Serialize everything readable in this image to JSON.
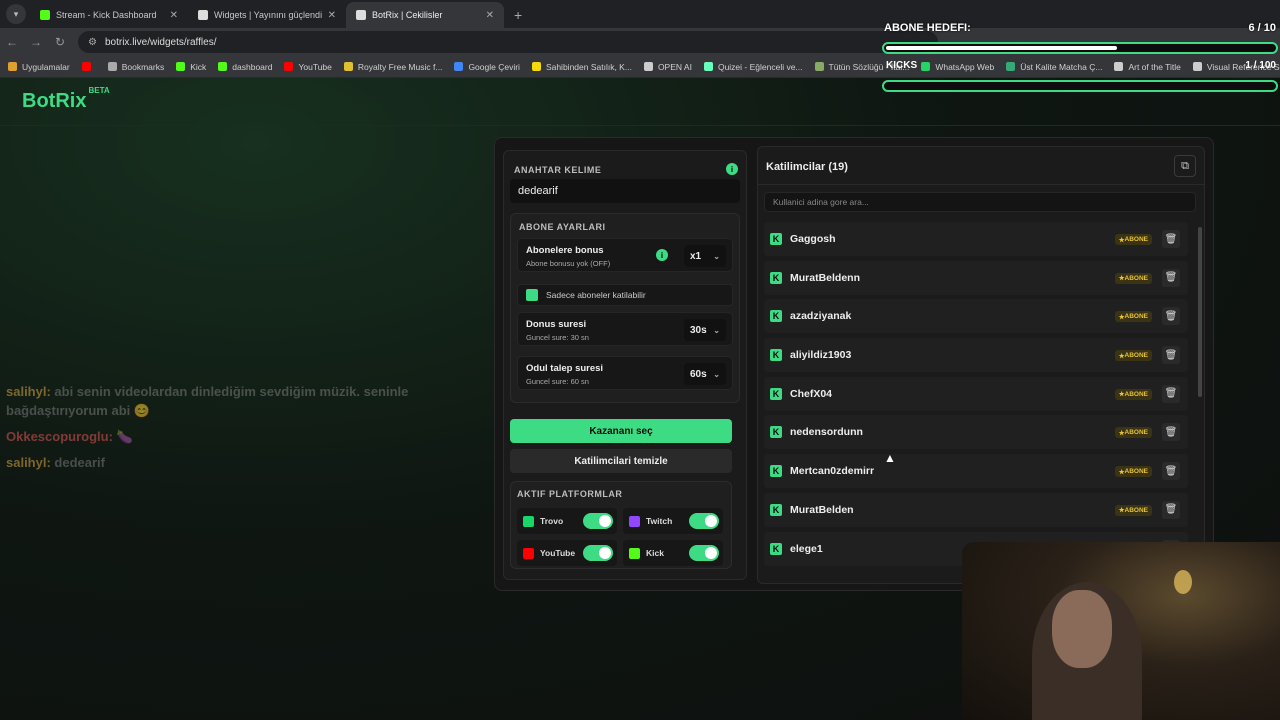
{
  "browser": {
    "tabs": [
      {
        "label": "Stream - Kick Dashboard",
        "color": "#53fc18"
      },
      {
        "label": "Widgets | Yayınını güçlendirmek",
        "color": "#ddd"
      },
      {
        "label": "BotRix | Cekilisler",
        "color": "#ddd"
      }
    ],
    "url": "botrix.live/widgets/raffles/",
    "bookmarks": [
      {
        "label": "Uygulamalar",
        "color": "#e0a030"
      },
      {
        "label": "",
        "color": "#ff0000"
      },
      {
        "label": "Bookmarks",
        "color": "#aaa"
      },
      {
        "label": "Kick",
        "color": "#53fc18"
      },
      {
        "label": "dashboard",
        "color": "#53fc18"
      },
      {
        "label": "YouTube",
        "color": "#ff0000"
      },
      {
        "label": "Royalty Free Music f...",
        "color": "#e0c030"
      },
      {
        "label": "Google Çeviri",
        "color": "#4285f4"
      },
      {
        "label": "Sahibinden Satılık, K...",
        "color": "#f5d90a"
      },
      {
        "label": "OPEN AI",
        "color": "#ccc"
      },
      {
        "label": "Quizei - Eğlenceli ve...",
        "color": "#6fb"
      },
      {
        "label": "Tütün Sözlüğü - İtal...",
        "color": "#8a6"
      },
      {
        "label": "WhatsApp Web",
        "color": "#25d366"
      },
      {
        "label": "Üst Kalite Matcha Ç...",
        "color": "#3a7"
      },
      {
        "label": "Art of the Title",
        "color": "#ccc"
      },
      {
        "label": "Visual Reference Se...",
        "color": "#ccc"
      }
    ]
  },
  "site": {
    "logo": "BotRix",
    "logo_sup": "BETA"
  },
  "chat": [
    {
      "user": "salihyl:",
      "text": " abi senin videolardan dinlediğim sevdiğim müzik. seninle bağdaştırıyorum abi 😊",
      "ucls": "u1"
    },
    {
      "user": "Okkescopuroglu:",
      "text": " 🍆",
      "ucls": "u2"
    },
    {
      "user": "salihyl:",
      "text": " dedearif",
      "ucls": "u1"
    }
  ],
  "raffle": {
    "keyword_title": "ANAHTAR KELIME",
    "keyword_value": "dedearif",
    "sub_title": "ABONE AYARLARI",
    "sub_bonus_label": "Abonelere bonus",
    "sub_bonus_sub": "Abone bonusu yok (OFF)",
    "sub_bonus_value": "x1",
    "subs_only_label": "Sadece aboneler katilabilir",
    "duration_label": "Donus suresi",
    "duration_sub": "Guncel sure: 30 sn",
    "duration_value": "30s",
    "claim_label": "Odul talep suresi",
    "claim_sub": "Guncel sure: 60 sn",
    "claim_value": "60s",
    "pick_button": "Kazananı seç",
    "clear_button": "Katilimcilari temizle",
    "platforms_title": "AKTIF PLATFORMLAR",
    "platforms": [
      {
        "name": "Trovo",
        "color": "#19d66b",
        "icon": "trovo-icon"
      },
      {
        "name": "Twitch",
        "color": "#9146ff",
        "icon": "twitch-icon"
      },
      {
        "name": "YouTube",
        "color": "#ff0000",
        "icon": "youtube-icon"
      },
      {
        "name": "Kick",
        "color": "#53fc18",
        "icon": "kick-icon"
      }
    ]
  },
  "participants": {
    "title": "Katilimcilar (19)",
    "search_placeholder": "Kullanici adina gore ara...",
    "badge": "ABONE",
    "list": [
      "Gaggosh",
      "MuratBeldenn",
      "azadziyanak",
      "aliyildiz1903",
      "ChefX04",
      "nedensordunn",
      "Mertcan0zdemirr",
      "MuratBelden",
      "elege1"
    ]
  },
  "overlay": {
    "goal_title": "ABONE HEDEFI:",
    "goal_count": "6 / 10",
    "goal_progress": 0.6,
    "kicks_title": "KICKS",
    "kicks_count": "1 / 100"
  }
}
